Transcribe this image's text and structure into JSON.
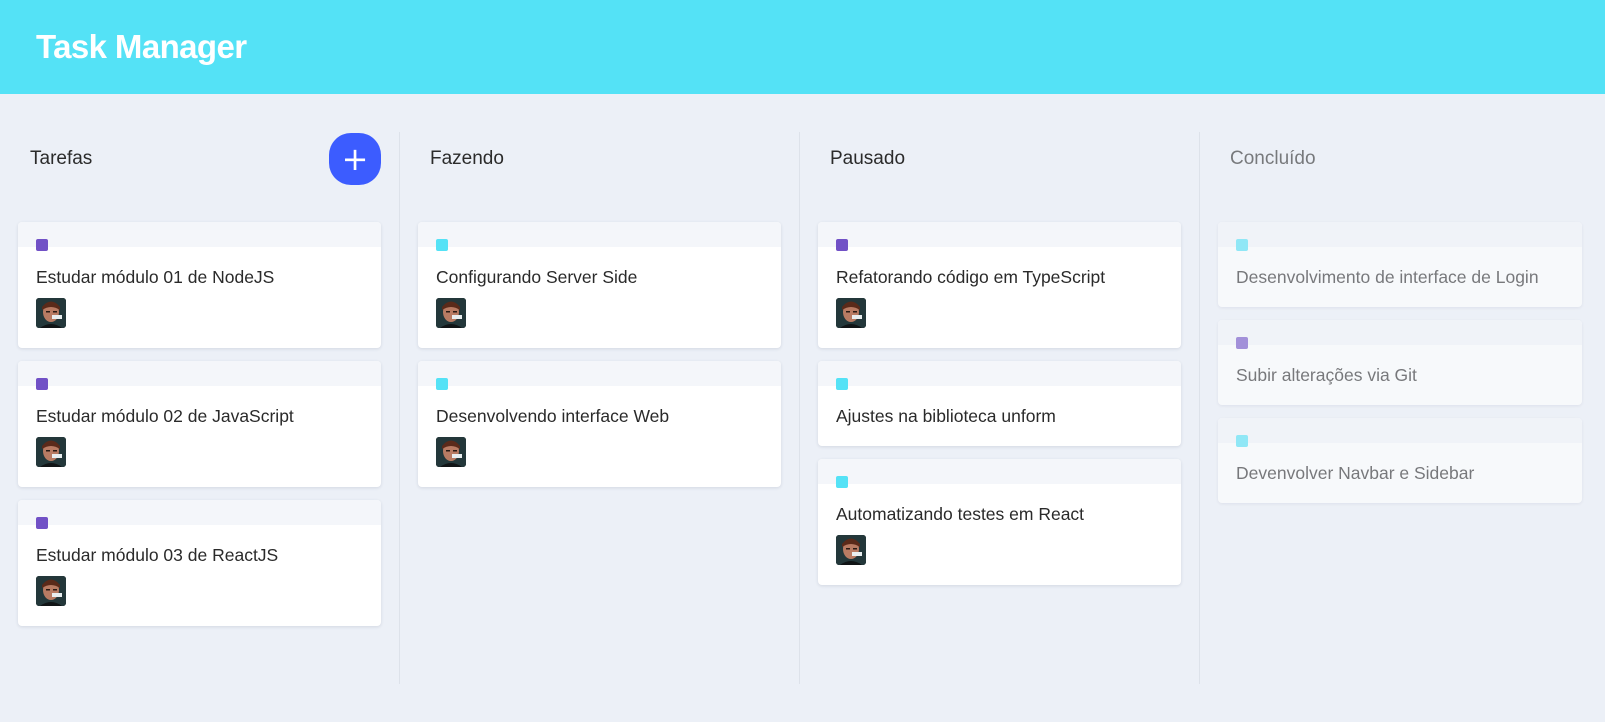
{
  "app": {
    "title": "Task Manager"
  },
  "colors": {
    "header": "#54e2f6",
    "accent": "#3c5cff",
    "label_purple": "#7151c6",
    "label_cyan": "#54e2f6"
  },
  "icons": {
    "add": "plus-icon",
    "avatar": "user-avatar"
  },
  "columns": [
    {
      "title": "Tarefas",
      "add_label": "+",
      "cards": [
        {
          "title": "Estudar módulo 01 de NodeJS",
          "label_color": "#7151c6",
          "has_avatar": true
        },
        {
          "title": "Estudar módulo 02 de JavaScript",
          "label_color": "#7151c6",
          "has_avatar": true
        },
        {
          "title": "Estudar módulo 03 de ReactJS",
          "label_color": "#7151c6",
          "has_avatar": true
        }
      ]
    },
    {
      "title": "Fazendo",
      "cards": [
        {
          "title": "Configurando Server Side",
          "label_color": "#54e2f6",
          "has_avatar": true
        },
        {
          "title": "Desenvolvendo interface Web",
          "label_color": "#54e2f6",
          "has_avatar": true
        }
      ]
    },
    {
      "title": "Pausado",
      "cards": [
        {
          "title": "Refatorando código em TypeScript",
          "label_color": "#7151c6",
          "has_avatar": true
        },
        {
          "title": "Ajustes na biblioteca unform",
          "label_color": "#54e2f6",
          "has_avatar": false
        },
        {
          "title": "Automatizando testes em React",
          "label_color": "#54e2f6",
          "has_avatar": true
        }
      ]
    },
    {
      "title": "Concluído",
      "cards": [
        {
          "title": "Desenvolvimento de interface de Login",
          "label_color": "#54e2f6",
          "has_avatar": false
        },
        {
          "title": "Subir alterações via Git",
          "label_color": "#7151c6",
          "has_avatar": false
        },
        {
          "title": "Devenvolver Navbar e Sidebar",
          "label_color": "#54e2f6",
          "has_avatar": false
        }
      ]
    }
  ]
}
